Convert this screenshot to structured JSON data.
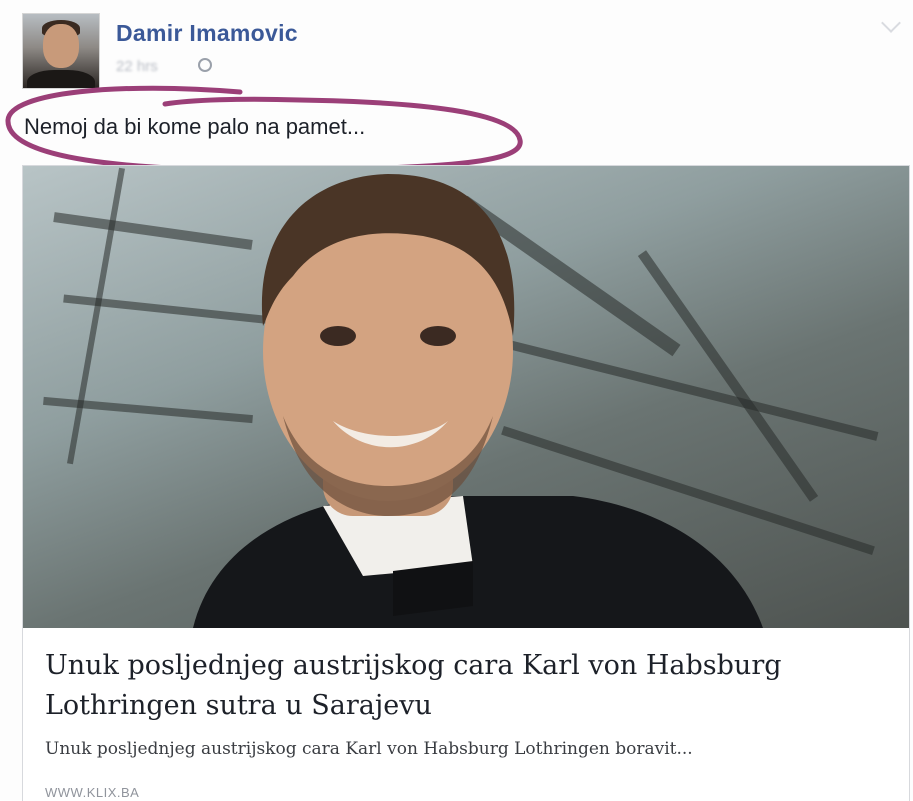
{
  "post": {
    "author_name": "Damir Imamovic",
    "timestamp": "22 hrs",
    "privacy_icon": "globe-icon",
    "options_icon": "chevron-down-icon",
    "status_text": "Nemoj da bi kome palo na pamet..."
  },
  "link_preview": {
    "headline": "Unuk posljednjeg austrijskog cara Karl von Habsburg Lothringen sutra u Sarajevu",
    "description": "Unuk posljednjeg austrijskog cara Karl von Habsburg Lothringen boravit...",
    "domain": "WWW.KLIX.BA"
  },
  "colors": {
    "author_link": "#3b5998",
    "annotation_marker": "#9b3f78"
  }
}
